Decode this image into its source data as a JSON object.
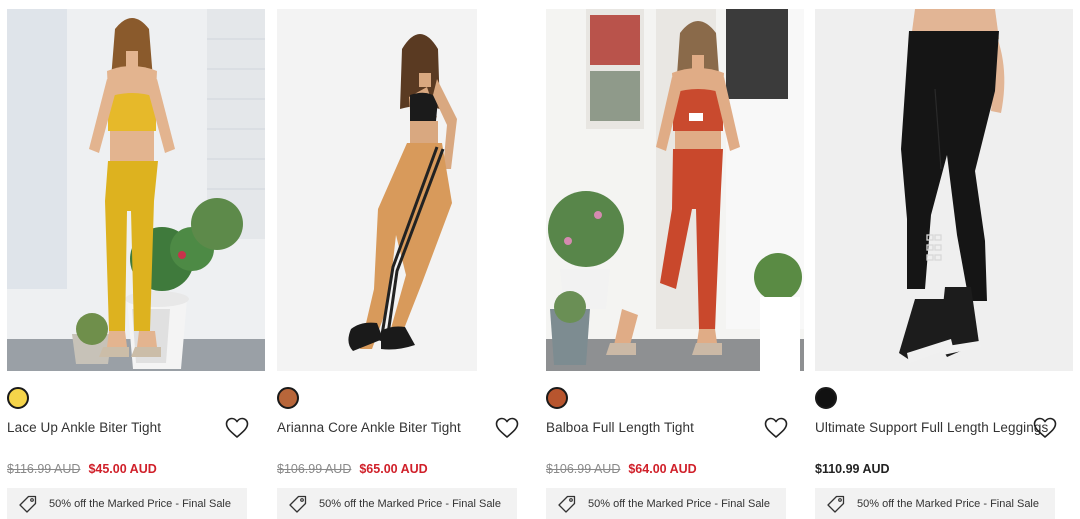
{
  "products": [
    {
      "name": "Lace Up Ankle Biter Tight",
      "swatch": "#f5d44a",
      "was_price": "$116.99 AUD",
      "price": "$45.00 AUD",
      "promo": "50% off the Marked Price - Final Sale"
    },
    {
      "name": "Arianna Core Ankle Biter Tight",
      "swatch": "#b8663a",
      "was_price": "$106.99 AUD",
      "price": "$65.00 AUD",
      "promo": "50% off the Marked Price - Final Sale"
    },
    {
      "name": "Balboa Full Length Tight",
      "swatch": "#b8552e",
      "was_price": "$106.99 AUD",
      "price": "$64.00 AUD",
      "promo": "50% off the Marked Price - Final Sale"
    },
    {
      "name": "Ultimate Support Full Length Leggings",
      "swatch": "#111111",
      "regular_price": "$110.99 AUD",
      "promo": "50% off the Marked Price - Final Sale"
    }
  ],
  "icons": {
    "wishlist": "heart-icon",
    "promo": "tag-icon"
  }
}
